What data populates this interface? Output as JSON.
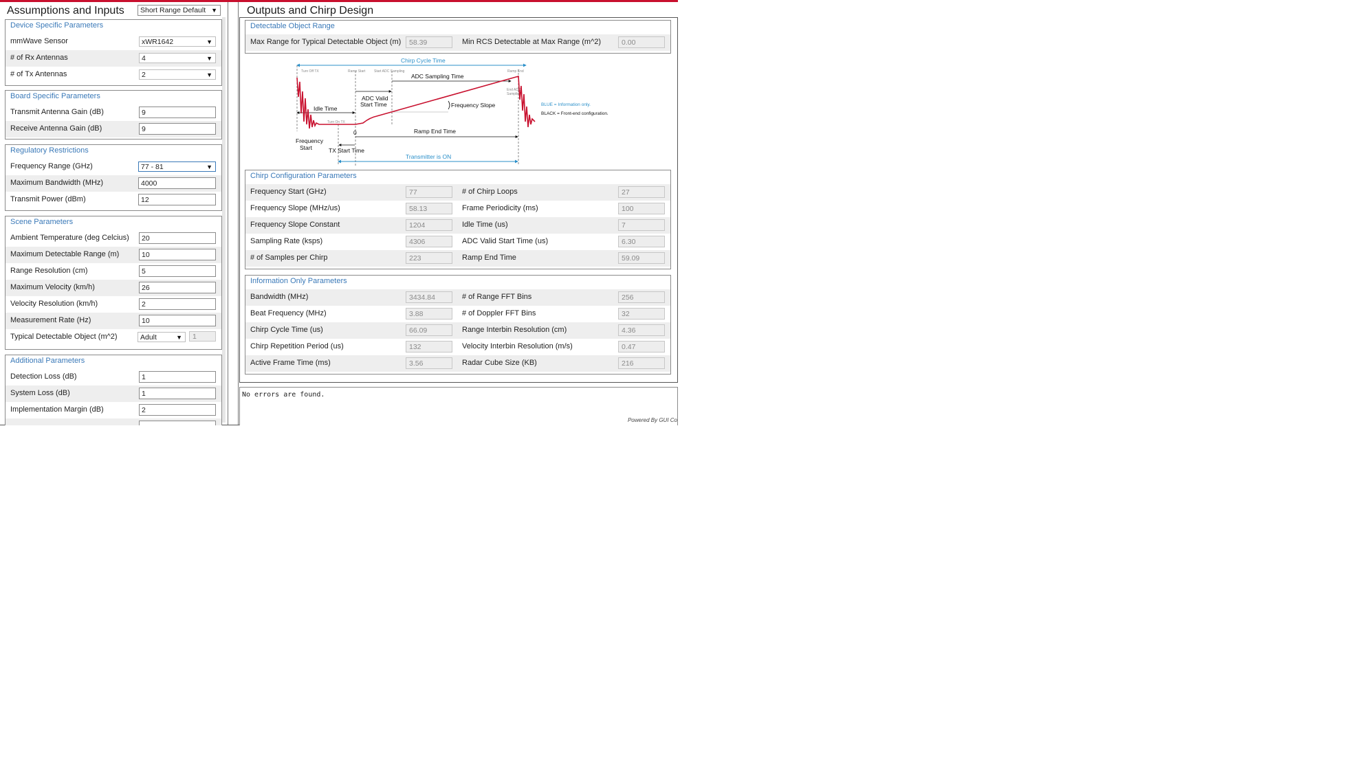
{
  "left_panel": {
    "title": "Assumptions and Inputs",
    "preset": "Short Range Default",
    "device": {
      "title": "Device Specific Parameters",
      "rows": [
        {
          "label": "mmWave Sensor",
          "value": "xWR1642"
        },
        {
          "label": "# of Rx Antennas",
          "value": "4"
        },
        {
          "label": "# of Tx Antennas",
          "value": "2"
        }
      ]
    },
    "board": {
      "title": "Board Specific Parameters",
      "rows": [
        {
          "label": "Transmit Antenna Gain (dB)",
          "value": "9"
        },
        {
          "label": "Receive Antenna Gain (dB)",
          "value": "9"
        }
      ]
    },
    "regulatory": {
      "title": "Regulatory Restrictions",
      "rows": [
        {
          "label": "Frequency Range (GHz)",
          "value": "77 - 81"
        },
        {
          "label": "Maximum Bandwidth (MHz)",
          "value": "4000"
        },
        {
          "label": "Transmit Power (dBm)",
          "value": "12"
        }
      ]
    },
    "scene": {
      "title": "Scene Parameters",
      "rows": [
        {
          "label": "Ambient Temperature (deg Celcius)",
          "value": "20"
        },
        {
          "label": "Maximum Detectable Range (m)",
          "value": "10"
        },
        {
          "label": "Range Resolution (cm)",
          "value": "5"
        },
        {
          "label": "Maximum Velocity (km/h)",
          "value": "26"
        },
        {
          "label": "Velocity Resolution (km/h)",
          "value": "2"
        },
        {
          "label": "Measurement Rate (Hz)",
          "value": "10"
        },
        {
          "label": "Typical Detectable Object (m^2)",
          "value": "Adult",
          "value2": "1"
        }
      ]
    },
    "additional": {
      "title": "Additional Parameters",
      "rows": [
        {
          "label": "Detection Loss (dB)",
          "value": "1"
        },
        {
          "label": "System Loss (dB)",
          "value": "1"
        },
        {
          "label": "Implementation Margin (dB)",
          "value": "2"
        }
      ]
    }
  },
  "right_panel": {
    "title": "Outputs and Chirp Design",
    "detectable": {
      "title": "Detectable Object Range",
      "max_range_label": "Max Range for Typical Detectable Object (m)",
      "max_range_value": "58.39",
      "min_rcs_label": "Min RCS Detectable at Max Range (m^2)",
      "min_rcs_value": "0.00"
    },
    "diagram": {
      "chirp_cycle_time": "Chirp Cycle Time",
      "turn_off_tx": "Turn Off TX",
      "ramp_start": "Ramp Start",
      "start_adc": "Start ADC Sampling",
      "ramp_end": "Ramp End",
      "adc_sampling_time": "ADC Sampling Time",
      "end_adc_1": "End ADC",
      "end_adc_2": "Sampling",
      "adc_valid_1": "ADC Valid",
      "adc_valid_2": "Start Time",
      "idle_time": "Idle Time",
      "frequency_slope": "Frequency Slope",
      "turn_on_tx": "Turn On TX",
      "zero": "0",
      "ramp_end_time": "Ramp End Time",
      "frequency_start_1": "Frequency",
      "frequency_start_2": "Start",
      "tx_start_time": "TX Start Time",
      "transmitter_on": "Transmitter is ON",
      "legend_blue": "BLUE = Information only.",
      "legend_black": "BLACK = Front-end configuration."
    },
    "chirp": {
      "title": "Chirp Configuration Parameters",
      "rows": [
        {
          "l1": "Frequency Start (GHz)",
          "v1": "77",
          "l2": "# of Chirp Loops",
          "v2": "27"
        },
        {
          "l1": "Frequency Slope (MHz/us)",
          "v1": "58.13",
          "l2": "Frame Periodicity (ms)",
          "v2": "100"
        },
        {
          "l1": "Frequency Slope Constant",
          "v1": "1204",
          "l2": "Idle Time (us)",
          "v2": "7"
        },
        {
          "l1": "Sampling Rate (ksps)",
          "v1": "4306",
          "l2": "ADC Valid Start Time (us)",
          "v2": "6.30"
        },
        {
          "l1": "# of Samples per Chirp",
          "v1": "223",
          "l2": "Ramp End Time",
          "v2": "59.09"
        }
      ]
    },
    "info": {
      "title": "Information Only Parameters",
      "rows": [
        {
          "l1": "Bandwidth (MHz)",
          "v1": "3434.84",
          "l2": "# of Range FFT Bins",
          "v2": "256"
        },
        {
          "l1": "Beat Frequency (MHz)",
          "v1": "3.88",
          "l2": "# of Doppler FFT Bins",
          "v2": "32"
        },
        {
          "l1": "Chirp Cycle Time (us)",
          "v1": "66.09",
          "l2": "Range Interbin Resolution (cm)",
          "v2": "4.36"
        },
        {
          "l1": "Chirp Repetition Period (us)",
          "v1": "132",
          "l2": "Velocity Interbin Resolution (m/s)",
          "v2": "0.47"
        },
        {
          "l1": "Active Frame Time (ms)",
          "v1": "3.56",
          "l2": "Radar Cube Size (KB)",
          "v2": "216"
        }
      ]
    },
    "log": {
      "text": "No errors are found.",
      "powered": "Powered By GUI Co"
    }
  },
  "colors": {
    "accent_red": "#c8102e",
    "group_title_blue": "#3a79b8",
    "diagram_blue": "#2a8fc9"
  }
}
